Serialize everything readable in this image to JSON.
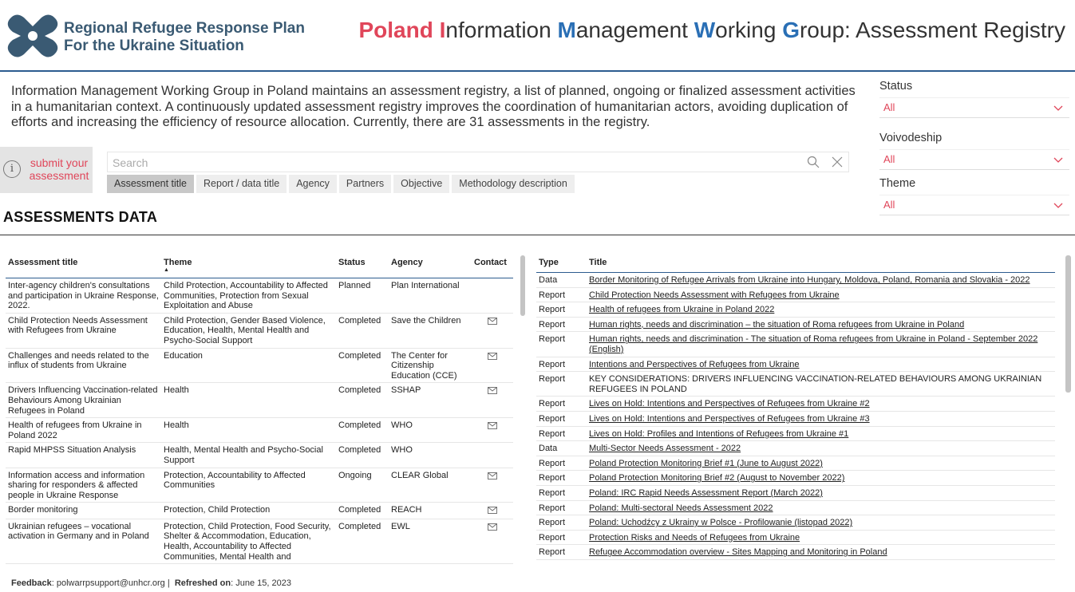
{
  "header": {
    "logo_line1": "Regional Refugee Response Plan",
    "logo_line2": "For the Ukraine Situation",
    "title_parts": [
      {
        "text": "P",
        "style": "r"
      },
      {
        "text": "oland ",
        "style": "r"
      },
      {
        "text": "I",
        "style": "r"
      },
      {
        "text": "nformation ",
        "style": ""
      },
      {
        "text": "M",
        "style": "b"
      },
      {
        "text": "anagement ",
        "style": ""
      },
      {
        "text": "W",
        "style": "b"
      },
      {
        "text": "orking ",
        "style": ""
      },
      {
        "text": "G",
        "style": "b"
      },
      {
        "text": "roup: Assessment Registry",
        "style": ""
      }
    ]
  },
  "intro": "Information Management Working Group in Poland maintains an assessment registry, a list of planned, ongoing or finalized assessment activities in a humanitarian context. A continuously updated assessment registry improves the coordination of humanitarian actors, avoiding duplication of efforts and increasing the efficiency of resource allocation. Currently, there are 31 assessments in the registry.",
  "filters": {
    "status_label": "Status",
    "status_value": "All",
    "voivodeship_label": "Voivodeship",
    "voivodeship_value": "All",
    "theme_label": "Theme",
    "theme_value": "All"
  },
  "submit": {
    "line1": "submit your",
    "line2": "assessment"
  },
  "search": {
    "placeholder": "Search"
  },
  "tabs": [
    "Assessment title",
    "Report / data title",
    "Agency",
    "Partners",
    "Objective",
    "Methodology description"
  ],
  "section_title": "ASSESSMENTS DATA",
  "left_table": {
    "headers": [
      "Assessment title",
      "Theme",
      "Status",
      "Agency",
      "Contact"
    ],
    "rows": [
      {
        "title": "Inter-agency children's consultations and participation in Ukraine Response, 2022.",
        "theme": "Child Protection, Accountability to Affected Communities, Protection from Sexual Exploitation and Abuse",
        "status": "Planned",
        "agency": "Plan International",
        "mail": false
      },
      {
        "title": "Child Protection Needs Assessment with Refugees from Ukraine",
        "theme": "Child Protection, Gender Based Violence, Education, Health, Mental Health and Psycho-Social Support",
        "status": "Completed",
        "agency": "Save the Children",
        "mail": true
      },
      {
        "title": "Challenges and needs related to the influx of students from Ukraine",
        "theme": "Education",
        "status": "Completed",
        "agency": "The Center for Citizenship Education (CCE)",
        "mail": true
      },
      {
        "title": "Drivers Influencing Vaccination-related Behaviours Among Ukrainian Refugees in Poland",
        "theme": "Health",
        "status": "Completed",
        "agency": "SSHAP",
        "mail": true
      },
      {
        "title": "Health of refugees from Ukraine in Poland 2022",
        "theme": "Health",
        "status": "Completed",
        "agency": "WHO",
        "mail": true
      },
      {
        "title": "Rapid MHPSS Situation Analysis",
        "theme": "Health, Mental Health and Psycho-Social Support",
        "status": "Completed",
        "agency": "WHO",
        "mail": false
      },
      {
        "title": "Information access and information sharing for responders & affected people in Ukraine Response",
        "theme": "Protection, Accountability to Affected Communities",
        "status": "Ongoing",
        "agency": "CLEAR Global",
        "mail": true
      },
      {
        "title": "Border monitoring",
        "theme": "Protection, Child Protection",
        "status": "Completed",
        "agency": "REACH",
        "mail": true
      },
      {
        "title": "Ukrainian refugees – vocational activation in Germany and in Poland",
        "theme": "Protection, Child Protection, Food Security, Shelter & Accommodation, Education, Health, Accountability to Affected Communities, Mental Health and",
        "status": "Completed",
        "agency": "EWL",
        "mail": true
      }
    ]
  },
  "right_table": {
    "headers": [
      "Type",
      "Title"
    ],
    "rows": [
      {
        "type": "Data",
        "title": "Border Monitoring of Refugee Arrivals from Ukraine into Hungary, Moldova, Poland, Romania and Slovakia - 2022",
        "link": true
      },
      {
        "type": "Report",
        "title": "Child Protection Needs Assessment with Refugees from Ukraine",
        "link": true
      },
      {
        "type": "Report",
        "title": "Health of refugees from Ukraine in Poland 2022",
        "link": true
      },
      {
        "type": "Report",
        "title": "Human rights, needs and discrimination – the situation of Roma refugees from Ukraine in Poland",
        "link": true
      },
      {
        "type": "Report",
        "title": "Human rights, needs and discrimination - The situation of Roma refugees from Ukraine in Poland - September 2022 (English)",
        "link": true
      },
      {
        "type": "Report",
        "title": "Intentions and Perspectives of Refugees from Ukraine",
        "link": true
      },
      {
        "type": "Report",
        "title": "KEY CONSIDERATIONS: DRIVERS INFLUENCING VACCINATION-RELATED BEHAVIOURS AMONG UKRAINIAN REFUGEES IN POLAND",
        "link": false
      },
      {
        "type": "Report",
        "title": "Lives on Hold: Intentions and Perspectives of Refugees from Ukraine #2",
        "link": true
      },
      {
        "type": "Report",
        "title": "Lives on Hold: Intentions and Perspectives of Refugees from Ukraine #3",
        "link": true
      },
      {
        "type": "Report",
        "title": "Lives on Hold: Profiles and Intentions of Refugees from Ukraine #1",
        "link": true
      },
      {
        "type": "Data",
        "title": "Multi-Sector Needs Assessment - 2022",
        "link": true
      },
      {
        "type": "Report",
        "title": "Poland Protection Monitoring Brief #1 (June to August 2022)",
        "link": true
      },
      {
        "type": "Report",
        "title": "Poland Protection Monitoring Brief #2 (August to November 2022)",
        "link": true
      },
      {
        "type": "Report",
        "title": "Poland: IRC Rapid Needs Assessment Report (March 2022)",
        "link": true
      },
      {
        "type": "Report",
        "title": "Poland: Multi-sectoral Needs Assessment 2022",
        "link": true
      },
      {
        "type": "Report",
        "title": "Poland: Uchodźcy z Ukrainy w Polsce - Profilowanie (listopad 2022)",
        "link": true
      },
      {
        "type": "Report",
        "title": "Protection Risks and Needs of Refugees from Ukraine",
        "link": true
      },
      {
        "type": "Report",
        "title": "Refugee Accommodation overview - Sites Mapping and Monitoring in Poland",
        "link": true
      }
    ]
  },
  "footer": {
    "feedback_label": "Feedback",
    "feedback_value": ": polwarrpsupport@unhcr.org |",
    "refreshed_label": "Refreshed on",
    "refreshed_value": ": June 15, 2023"
  },
  "colors": {
    "accent_red": "#e0465a",
    "accent_blue": "#2a6fb5",
    "rule_blue": "#2c5c8f"
  }
}
